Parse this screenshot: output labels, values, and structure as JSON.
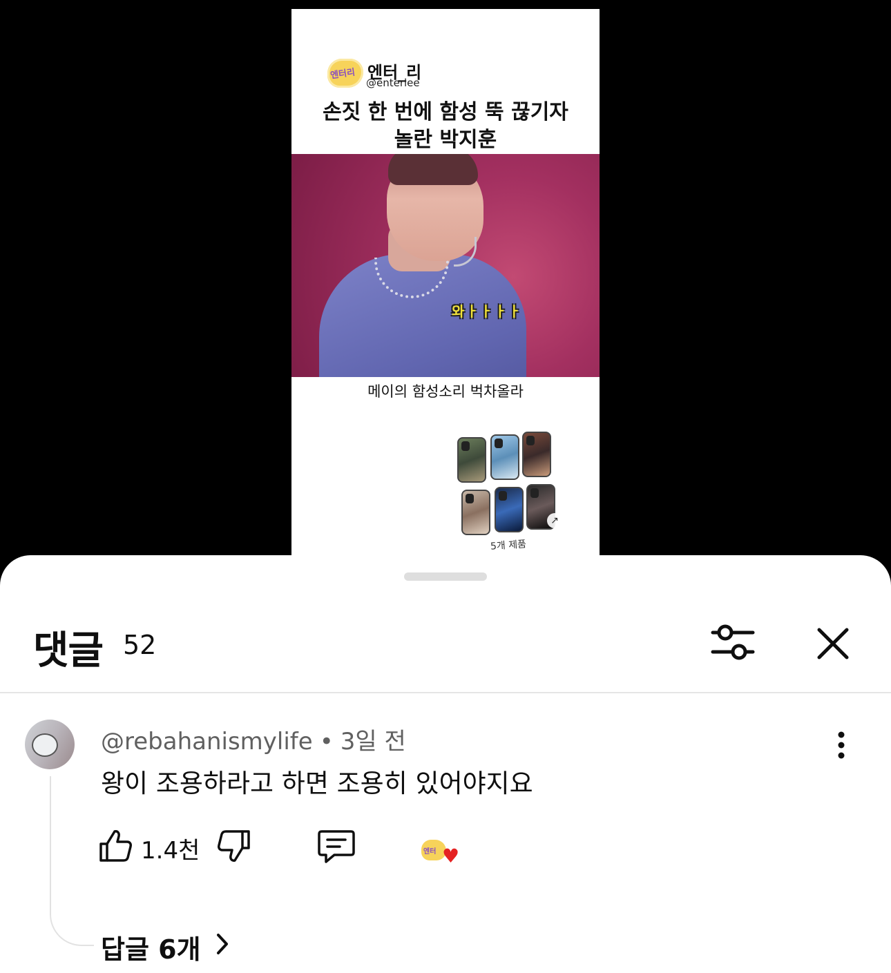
{
  "short": {
    "channel_badge": "엔터리",
    "channel_name": "엔터_리",
    "channel_handle": "@enterlee",
    "title_line1": "손짓 한 번에 함성 뚝 끊기자",
    "title_line2": "놀란 박지훈",
    "caption_sticker": "와ㅏㅏㅏㅏ",
    "subtitle": "메이의 함성소리 벅차올라",
    "product_count": "5개 제품"
  },
  "comments": {
    "title": "댓글",
    "count": "52",
    "icons": {
      "filter": "sliders-icon",
      "close": "close-icon",
      "menu": "more-vertical-icon",
      "like": "thumbs-up-icon",
      "dislike": "thumbs-down-icon",
      "reply": "comment-icon",
      "replies_chevron": "chevron-right-icon"
    },
    "items": [
      {
        "author": "@rebahanismylife",
        "separator": "•",
        "time": "3일 전",
        "text": "왕이 조용하라고 하면 조용히 있어야지요",
        "likes": "1.4천",
        "creator_heart_badge": "엔터",
        "replies_label": "답글 6개"
      }
    ]
  },
  "colors": {
    "sheet_bg": "#ffffff",
    "text_primary": "#0f0f0f",
    "text_secondary": "#606060",
    "heart": "#e52222",
    "badge_yellow": "#f7d35a"
  }
}
